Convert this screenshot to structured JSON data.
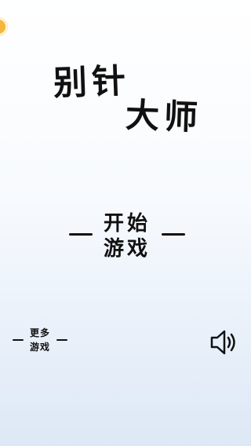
{
  "game": {
    "title_line1": "别针",
    "title_line2": "大师"
  },
  "menu": {
    "start_line1": "开始",
    "start_line2": "游戏",
    "more_line1": "更多",
    "more_line2": "游戏"
  },
  "icons": {
    "sound": "speaker-icon",
    "corner": "coin-icon"
  },
  "colors": {
    "text": "#111111",
    "background_top": "#ffffff",
    "background_bottom": "#dde8f6",
    "badge": "#f4b63d"
  }
}
